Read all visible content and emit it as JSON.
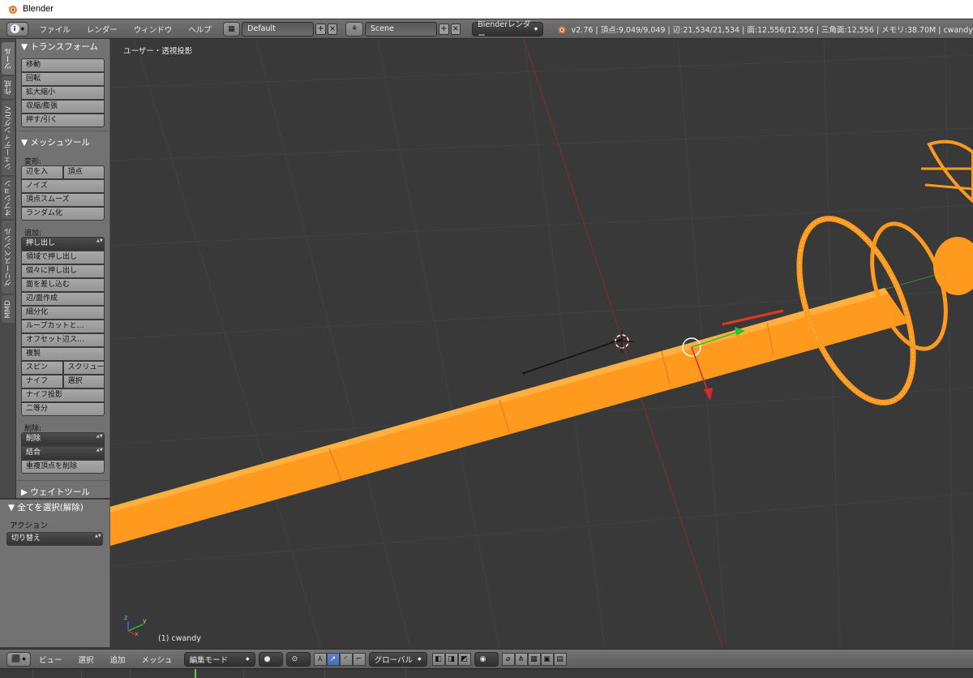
{
  "window": {
    "title": "Blender"
  },
  "topbar": {
    "menus": [
      "ファイル",
      "レンダー",
      "ウィンドウ",
      "ヘルプ"
    ],
    "layout": "Default",
    "scene": "Scene",
    "render_engine": "Blenderレンダー",
    "stats": "v2.76 | 頂点:9,049/9,049 | 辺:21,534/21,534 | 面:12,556/12,556 | 三角面:12,556 | メモリ:38.70M | cwandy"
  },
  "tabs": [
    "ツール",
    "作成",
    "シェーディング/UV",
    "オプション",
    "グリースペンシル",
    "MMD"
  ],
  "transform_panel": {
    "title": "▼ トランスフォーム",
    "buttons": [
      "移動",
      "回転",
      "拡大縮小",
      "収縮/膨張",
      "押す/引く"
    ]
  },
  "mesh_panel": {
    "title": "▼ メッシュツール",
    "deform_label": "変形:",
    "deform_row": [
      "辺を入",
      "頂点"
    ],
    "deform_buttons": [
      "ノイズ",
      "頂点スムーズ",
      "ランダム化"
    ],
    "add_label": "追加:",
    "extrude": "押し出し",
    "add_buttons": [
      "領域で押し出し",
      "個々に押し出し",
      "面を差し込む",
      "辺/面作成",
      "細分化",
      "ループカットと…",
      "オフセット辺ス…",
      "複製"
    ],
    "spin_row": [
      "スピン",
      "スクリュー"
    ],
    "knife_row": [
      "ナイフ",
      "選択"
    ],
    "add_buttons2": [
      "ナイフ投影",
      "二等分"
    ],
    "delete_label": "削除:",
    "delete": "削除",
    "merge": "結合",
    "remove_doubles": "重複頂点を削除"
  },
  "weight_panel": {
    "title": "▶ ウェイトツール"
  },
  "operator_panel": {
    "title": "▼ 全てを選択(解除)",
    "action_label": "アクション",
    "action_value": "切り替え"
  },
  "viewport": {
    "view_label": "ユーザー・透視投影",
    "object_label": "(1) cwandy",
    "axis_x": "x",
    "axis_y": "y",
    "axis_z": "z"
  },
  "bottombar": {
    "menus": [
      "ビュー",
      "選択",
      "追加",
      "メッシュ"
    ],
    "mode": "編集モード",
    "orientation": "グローバル"
  },
  "colors": {
    "mesh": "#ff9a1e",
    "wire": "#ffb040",
    "grid": "#414141",
    "x_axis": "#8a2a2a",
    "y_axis": "#3a8a2a"
  }
}
